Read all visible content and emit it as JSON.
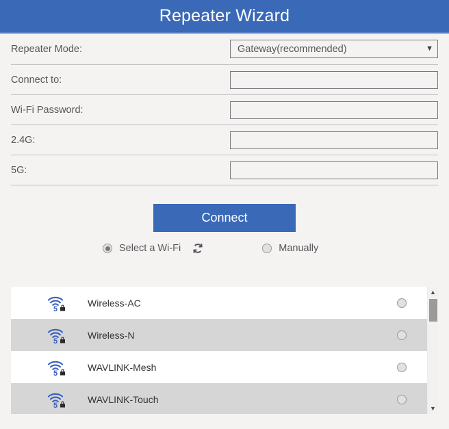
{
  "header": {
    "title": "Repeater Wizard",
    "background_color": "#3a69b8",
    "text_color": "#ffffff"
  },
  "form": {
    "rows": [
      {
        "label": "Repeater Mode:",
        "type": "select",
        "value": "Gateway(recommended)",
        "arrow_icon": "chevron-down-icon"
      },
      {
        "label": "Connect to:",
        "type": "text",
        "value": "",
        "placeholder": ""
      },
      {
        "label": "Wi-Fi Password:",
        "type": "text",
        "value": "",
        "placeholder": ""
      },
      {
        "label": "2.4G:",
        "type": "text",
        "value": "",
        "placeholder": ""
      },
      {
        "label": "5G:",
        "type": "text",
        "value": "",
        "placeholder": ""
      }
    ]
  },
  "actions": {
    "connect_label": "Connect",
    "connect_color": "#3a69b8"
  },
  "mode": {
    "select_wifi_label": "Select a Wi-Fi",
    "select_wifi_selected": true,
    "refresh_icon": "refresh-icon",
    "manually_label": "Manually",
    "manually_selected": false
  },
  "wifi_list": {
    "networks": [
      {
        "ssid": "Wireless-AC",
        "band": "5",
        "secured": true,
        "selected": false
      },
      {
        "ssid": "Wireless-N",
        "band": "5",
        "secured": true,
        "selected": false
      },
      {
        "ssid": "WAVLINK-Mesh",
        "band": "5",
        "secured": true,
        "selected": false
      },
      {
        "ssid": "WAVLINK-Touch",
        "band": "5",
        "secured": true,
        "selected": false
      }
    ],
    "signal_icon": "wifi-signal-icon",
    "lock_icon": "lock-icon",
    "icon_color": "#3a5fbc"
  },
  "scrollbar": {
    "up_arrow": "scroll-up-arrow-icon",
    "down_arrow": "scroll-down-arrow-icon",
    "thumb": "scrollbar-thumb"
  }
}
